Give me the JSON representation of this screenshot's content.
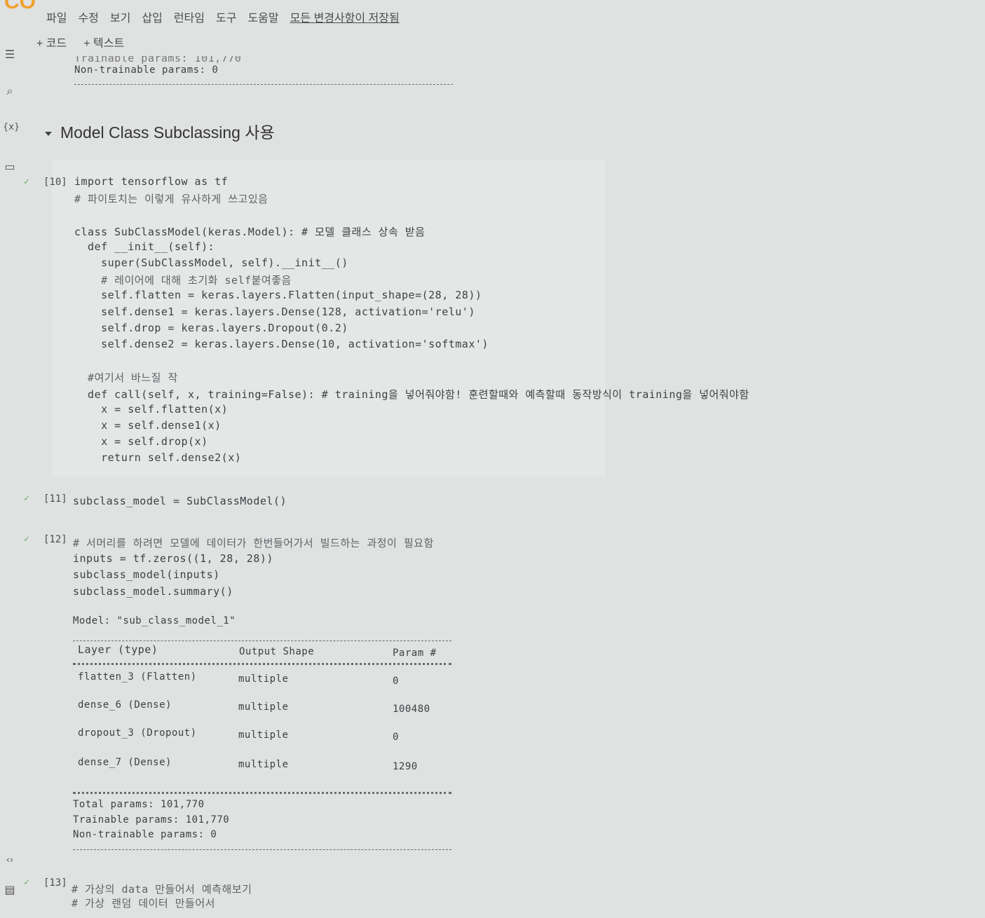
{
  "menu": [
    "파일",
    "수정",
    "보기",
    "삽입",
    "런타임",
    "도구",
    "도움말"
  ],
  "saved_status": "모든 변경사항이 저장됨",
  "toolbar": {
    "add_code": "+ 코드",
    "add_text": "+ 텍스트"
  },
  "prev_output": {
    "trainable": "Trainable params: 101,770",
    "non_trainable": "Non-trainable params: 0"
  },
  "section_title": "Model Class Subclassing 사용",
  "cell10": {
    "exec": "[10]",
    "lines": [
      "import tensorflow as tf",
      "# 파이토치는 이렇게 유사하게 쓰고있음",
      "",
      "class SubClassModel(keras.Model): # 모델 클래스 상속 받음",
      "  def __init__(self):",
      "    super(SubClassModel, self).__init__()",
      "    # 레이어에 대해 초기화 self붙여좋음",
      "    self.flatten = keras.layers.Flatten(input_shape=(28, 28))",
      "    self.dense1 = keras.layers.Dense(128, activation='relu')",
      "    self.drop = keras.layers.Dropout(0.2)",
      "    self.dense2 = keras.layers.Dense(10, activation='softmax')",
      "",
      "  #여기서 바느질 작",
      "  def call(self, x, training=False): # training을 넣어줘야함! 훈련할때와 예측할때 동작방식이 training을 넣어줘야함",
      "    x = self.flatten(x)",
      "    x = self.dense1(x)",
      "    x = self.drop(x)",
      "    return self.dense2(x)"
    ]
  },
  "cell11": {
    "exec": "[11]",
    "lines": [
      "subclass_model = SubClassModel()"
    ]
  },
  "cell12": {
    "exec": "[12]",
    "lines": [
      "# 서머리를 하려면 모델에 데이터가 한번들어가서 빌드하는 과정이 필요함",
      "inputs = tf.zeros((1, 28, 28))",
      "subclass_model(inputs)",
      "subclass_model.summary()"
    ],
    "model_name": "Model: \"sub_class_model_1\"",
    "headers": [
      "Layer (type)",
      "Output Shape",
      "Param #"
    ],
    "rows": [
      [
        "flatten_3 (Flatten)",
        "multiple",
        "0"
      ],
      [
        "dense_6 (Dense)",
        "multiple",
        "100480"
      ],
      [
        "dropout_3 (Dropout)",
        "multiple",
        "0"
      ],
      [
        "dense_7 (Dense)",
        "multiple",
        "1290"
      ]
    ],
    "total": "Total params: 101,770",
    "trainable": "Trainable params: 101,770",
    "non_trainable": "Non-trainable params: 0"
  },
  "cell13": {
    "exec": "[13]",
    "lines": [
      "# 가상의 data 만들어서 예측해보기",
      "# 가상 랜덤 데이터 만들어서"
    ]
  },
  "sidebar_icons": [
    "toc-icon",
    "search-icon",
    "variables-icon",
    "files-icon",
    "code-snippets-icon",
    "terminal-icon"
  ]
}
